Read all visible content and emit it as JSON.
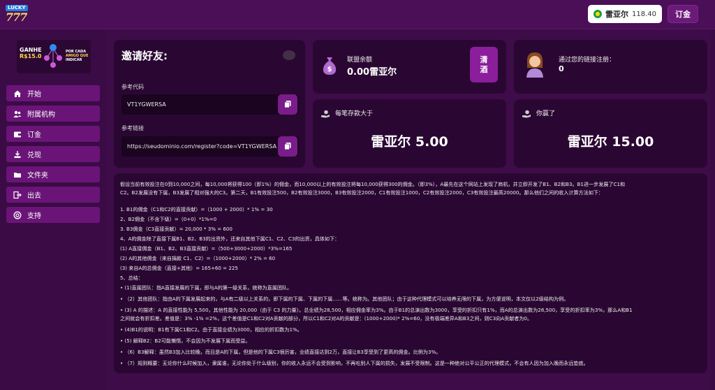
{
  "header": {
    "logo_top": "LUCKY",
    "logo_main": "777",
    "balance_currency": "雷亚尔",
    "balance_value": "118.40",
    "order_label": "订金"
  },
  "banner": {
    "left_line1": "GANHE",
    "left_line2": "R$15.0",
    "right_line1": "POR CADA",
    "right_line2": "AMIGO QUE",
    "right_line3": "INDICAR"
  },
  "sidebar": {
    "items": [
      {
        "label": "开始",
        "icon": "home-icon"
      },
      {
        "label": "附属机构",
        "icon": "users-icon"
      },
      {
        "label": "订金",
        "icon": "wallet-icon"
      },
      {
        "label": "兑现",
        "icon": "withdraw-icon"
      },
      {
        "label": "文件夹",
        "icon": "folder-icon"
      },
      {
        "label": "出去",
        "icon": "logout-icon"
      },
      {
        "label": "支持",
        "icon": "support-icon"
      }
    ]
  },
  "invite": {
    "title": "邀请好友:",
    "code_label": "参考代码",
    "code_value": "VT1YGWERSA",
    "link_label": "参考链接",
    "link_value": "https://seudominio.com/register?code=VT1YGWERSA"
  },
  "affiliate": {
    "title": "联盟余额",
    "value": "0.00雷亚尔",
    "clear_line1": "清",
    "clear_line2": "酒"
  },
  "referrals": {
    "title": "通过您的链接注册：",
    "value": "0"
  },
  "deposit": {
    "title": "每笔存款大于",
    "value": "雷亚尔 5.00"
  },
  "won": {
    "title": "你赢了",
    "value": "雷亚尔 15.00"
  },
  "rules": {
    "p1": "假设当前有效投注在0到10,000之间，每10,000将获得100（即1%）的佣金，而10,000以上的有效投注将每10,000获得300的佣金。（即3%），A最先在这个网站上发现了商机，并立即开发了B1、B2和B3。B1进一步发展了C1和",
    "p2": "C2。B2发展没有下属，B3发展了相对强大的C3。第二天，B1有效投注500，B2有效投注3000，B3有效投注2000，C1有效投注1000，C2有效投注2000，C3有效投注最高20000。那么他们之间的收入计算方法如下：",
    "l1": "1. B1的佣金（C1和C2的直接贡献）=（1000 + 2000）* 1% = 30",
    "l2": "2、B2佣金（不含下级）=（0+0）*1%=0",
    "l3": "3. B3佣金（C3直接贡献）= 20,000 * 3% = 600",
    "l4": "4、A的佣金除了直接下属B1、B2、B3的出资外，还来自其他下属C1、C2、C3的出资，具体如下：",
    "l5": "(1) A直接佣金（B1、B2、B3直接贡献）=（500+3000+2000）*3%=165",
    "l6": "(2) A的其他佣金（来自捐款 C1、C2）=（1000+2000）* 2% = 60",
    "l7": "(3) 来自A的总佣金（直接+其他）= 165+60 = 225",
    "l8": "5、总结：",
    "s1": "• (1)直属团队：指A直接发展的下属，即与A的第一级关系，统称为直属团队。",
    "s2": "• （2）其他团队：指由A的下属发展起来的，与A有二级以上关系的，即下属的下属、下属的下属……等。统称为。其他团队；由于这种代理模式可以培养无限的下属，为方便说明，本文仅以2级结构为例。",
    "s3a": "• (3) A 的描述：A 的直接性能为 5,500，其他性能为 20,000（由于 C3 的力量）。总业绩为28,500，相应佣金率为3%。由于B1的总演出数为3000，享受的折扣只有1%，而A的总演出数为28,500，享受的折扣率为3%，那么A和B1",
    "s3b": "之间就会有折扣差。差值是：3% -1% =2%，这个差值是C1和C2对A贡献的部分，所以C1和C2对A的贡献是：(1000+2000)* 2%=60，没有极端差异A和B3之间，则C3向A贡献者为0。",
    "s4": "• (4)B1的说明：B1有下属C1和C2。由于直接业绩为3000，相应的折扣数为1%。",
    "s5": "• (5) 解释B2：B2可能懒惰，不会因为不发展下属而受益。",
    "s6": "• （6）B3解释：虽然B3加入比较晚，而且是A的下属，但是他的下属C3很厉害，业绩直接达到2万，直接让B3享受到了更高的佣金。比例为3%。",
    "s7": "• （7）规则概要：无论你什么时候加入，隶属谁，无论你处于什么级别，你的收入永远不会受到影响，不再吃别人下属的损失，发展不受限制。这是一种绝对公平公正的代理模式，不会有人因为加入晚而永远垫底。"
  },
  "colors": {
    "background": "#3e0c48",
    "card": "#2a0732",
    "accent": "#7a1c8a",
    "nav": "#6a1478"
  }
}
